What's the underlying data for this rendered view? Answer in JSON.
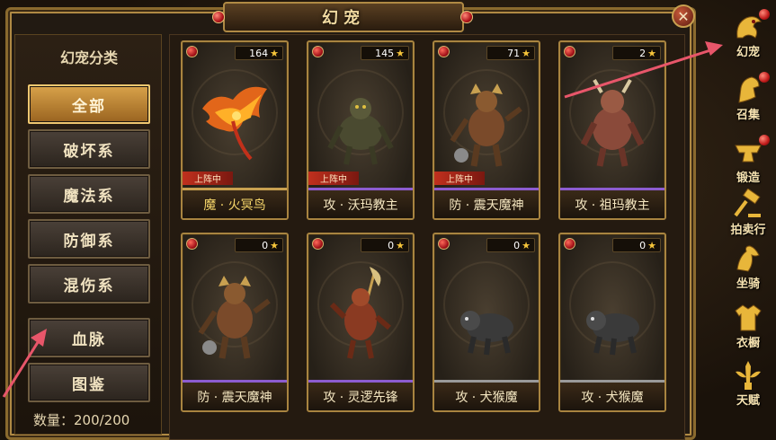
{
  "window": {
    "title": "幻宠",
    "close_label": "✕"
  },
  "categories": {
    "title": "幻宠分类",
    "items": [
      {
        "label": "全部",
        "active": true
      },
      {
        "label": "破坏系",
        "active": false
      },
      {
        "label": "魔法系",
        "active": false
      },
      {
        "label": "防御系",
        "active": false
      },
      {
        "label": "混伤系",
        "active": false
      },
      {
        "label": "血脉",
        "active": false
      },
      {
        "label": "图鉴",
        "active": false
      }
    ],
    "count_label": "数量：200/200"
  },
  "pets": [
    {
      "name": "魔 · 火冥鸟",
      "level": "164",
      "deployed": "上阵中",
      "rarity": "gold",
      "figure": "fire-bird"
    },
    {
      "name": "攻 · 沃玛教主",
      "level": "145",
      "deployed": "上阵中",
      "rarity": "purple",
      "figure": "woma-lord"
    },
    {
      "name": "防 · 震天魔神",
      "level": "71",
      "deployed": "上阵中",
      "rarity": "purple",
      "figure": "quake-demon"
    },
    {
      "name": "攻 · 祖玛教主",
      "level": "2",
      "deployed": "",
      "rarity": "purple",
      "figure": "zuma-lord"
    },
    {
      "name": "防 · 震天魔神",
      "level": "0",
      "deployed": "",
      "rarity": "purple",
      "figure": "quake-demon"
    },
    {
      "name": "攻 · 灵逻先锋",
      "level": "0",
      "deployed": "",
      "rarity": "purple",
      "figure": "spirit-vanguard"
    },
    {
      "name": "攻 · 犬猴魔",
      "level": "0",
      "deployed": "",
      "rarity": "white",
      "figure": "dog-monkey"
    },
    {
      "name": "攻 · 犬猴魔",
      "level": "0",
      "deployed": "",
      "rarity": "white",
      "figure": "dog-monkey"
    }
  ],
  "right_nav": [
    {
      "label": "幻宠",
      "icon": "dragon-icon",
      "dot": true
    },
    {
      "label": "召集",
      "icon": "horse-head-icon",
      "dot": true
    },
    {
      "label": "锻造",
      "icon": "anvil-icon",
      "dot": true
    },
    {
      "label": "拍卖行",
      "icon": "gavel-icon",
      "dot": false
    },
    {
      "label": "坐骑",
      "icon": "mount-icon",
      "dot": false
    },
    {
      "label": "衣橱",
      "icon": "robe-icon",
      "dot": false
    },
    {
      "label": "天赋",
      "icon": "sword-wings-icon",
      "dot": false
    }
  ],
  "colors": {
    "accent_gold": "#c8a050",
    "active_category": "#d8a24a",
    "rarity_purple": "#8c5cd0",
    "deployed_badge": "#c0301e",
    "annotation_arrow": "#e8566a"
  }
}
